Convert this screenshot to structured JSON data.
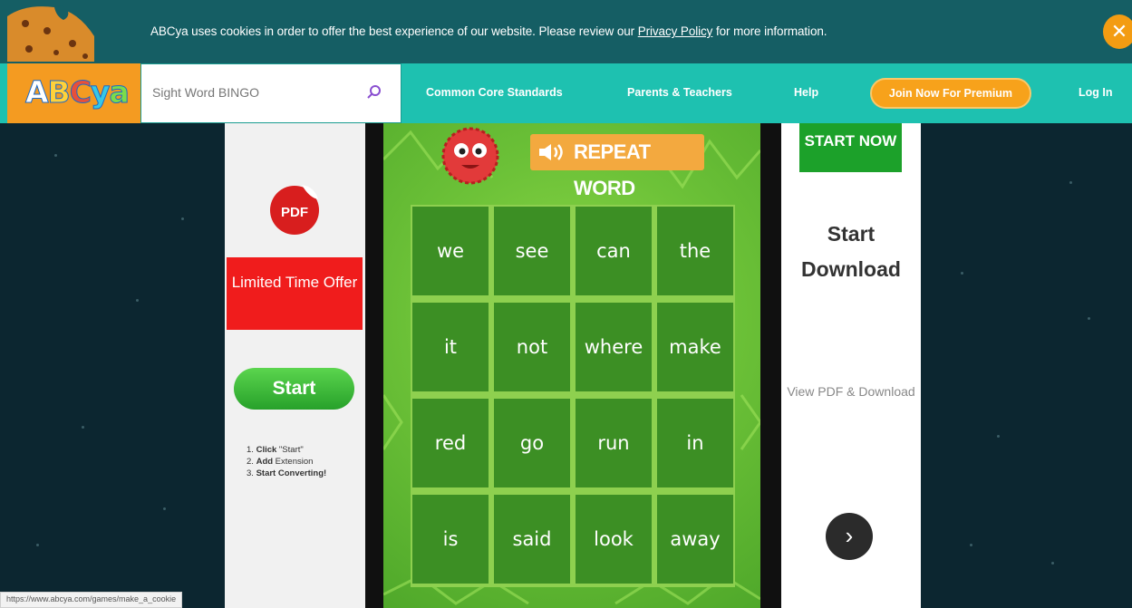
{
  "cookie_banner": {
    "text_before": "ABCya uses cookies in order to offer the best experience of our website. Please review our ",
    "link": "Privacy Policy",
    "text_after": " for more information.",
    "close_icon": "close-x-icon"
  },
  "nav": {
    "logo": "ABCya",
    "search_placeholder": "Sight Word BINGO",
    "search_icon": "search-icon",
    "links": [
      "Common Core Standards",
      "Parents & Teachers",
      "Help"
    ],
    "premium_button": "Join Now For Premium",
    "login": "Log In"
  },
  "left_ad": {
    "pdf_label": "PDF",
    "offer": "Limited Time Offer",
    "start_button": "Start",
    "steps": [
      {
        "num": "1.",
        "bold": "Click",
        "rest": " \"Start\""
      },
      {
        "num": "2.",
        "bold": "Add",
        "rest": " Extension"
      },
      {
        "num": "3.",
        "bold": "Start Converting!",
        "rest": ""
      }
    ]
  },
  "game": {
    "repeat_button": "REPEAT WORD",
    "words": [
      "we",
      "see",
      "can",
      "the",
      "it",
      "not",
      "where",
      "make",
      "red",
      "go",
      "run",
      "in",
      "is",
      "said",
      "look",
      "away"
    ]
  },
  "right_ad": {
    "start_now": "START NOW",
    "title": "Start Download",
    "subtitle": "View PDF & Download",
    "arrow_icon": "chevron-right-icon"
  },
  "status_bar": {
    "url": "https://www.abcya.com/games/make_a_cookie"
  },
  "colors": {
    "banner": "#155e64",
    "nav": "#1ec1b0",
    "logo_bg": "#f49b21",
    "premium": "#f7a21b",
    "tile": "#3c8f24",
    "offer_red": "#f01c1c",
    "start_green": "#1ca12a"
  }
}
